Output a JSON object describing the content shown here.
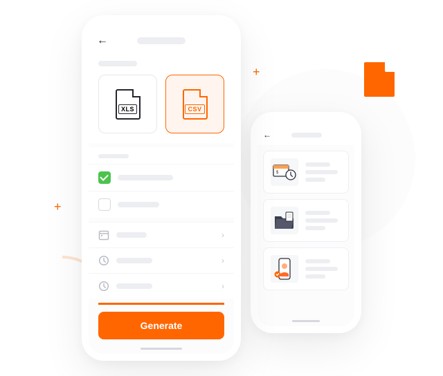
{
  "primary": {
    "formats": {
      "xls": {
        "label": "XLS"
      },
      "csv": {
        "label": "CSV",
        "selected": true
      }
    },
    "generate_label": "Generate"
  },
  "icons": {
    "back": "←",
    "chevron": "›",
    "plus": "+"
  }
}
